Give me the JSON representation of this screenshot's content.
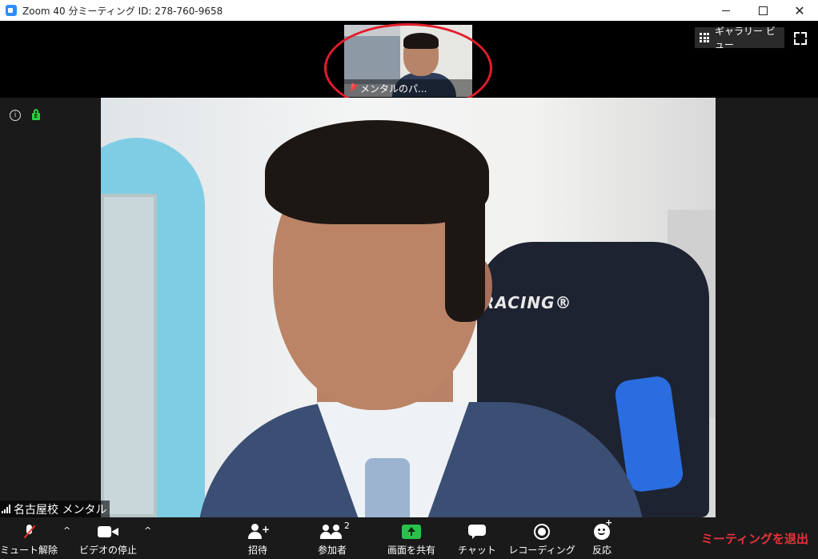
{
  "window": {
    "title": "Zoom 40 分ミーティング ID: 278-760-9658",
    "close_glyph": "✕"
  },
  "top": {
    "thumbnail_label": "メンタルのパ...",
    "gallery_view_label": "ギャラリー ビュー"
  },
  "status": {
    "info_glyph": "i"
  },
  "video": {
    "chair_brand": "RACING®",
    "participant_name": "名古屋校 メンタル"
  },
  "toolbar": {
    "unmute_label": "ミュート解除",
    "video_label": "ビデオの停止",
    "caret_glyph": "^",
    "invite_label": "招待",
    "invite_plus": "+",
    "participants_label": "参加者",
    "participants_count": "2",
    "share_label": "画面を共有",
    "chat_label": "チャット",
    "record_label": "レコーディング",
    "reactions_label": "反応",
    "reactions_plus": "+",
    "leave_label": "ミーティングを退出"
  },
  "colors": {
    "accent_green": "#27c24c",
    "leave_red": "#e8333a",
    "highlight_circle": "#e31d2b"
  }
}
